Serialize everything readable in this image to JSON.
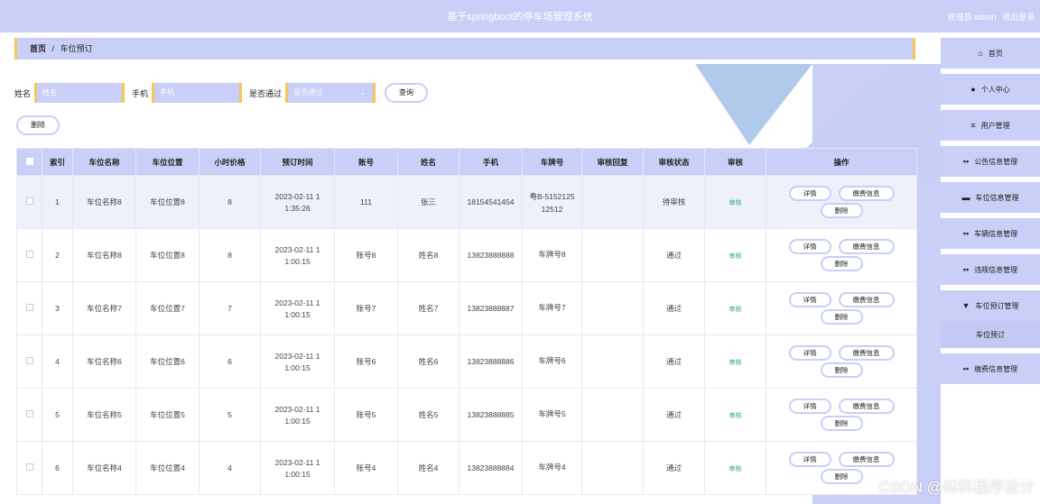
{
  "header": {
    "title": "基于springboot的停车场管理系统",
    "role": "管理员 admin",
    "logout": "退出登录"
  },
  "breadcrumb": {
    "home": "首页",
    "sep": "/",
    "current": "车位预订"
  },
  "search": {
    "name_label": "姓名",
    "name_placeholder": "姓名",
    "phone_label": "手机",
    "phone_placeholder": "手机",
    "pass_label": "是否通过",
    "pass_placeholder": "是否通过",
    "query_button": "查询"
  },
  "delete_button": "删除",
  "table": {
    "headers": [
      "索引",
      "车位名称",
      "车位位置",
      "小时价格",
      "预订时间",
      "账号",
      "姓名",
      "手机",
      "车牌号",
      "审核回复",
      "审核状态",
      "审核",
      "操作"
    ],
    "rows": [
      {
        "index": "1",
        "name": "车位名称8",
        "loc": "车位位置8",
        "price": "8",
        "time1": "2023-02-11 1",
        "time2": "1:35:26",
        "account": "111",
        "person": "张三",
        "phone": "18154541454",
        "plate1": "粤B-5152125",
        "plate2": "12512",
        "reply": "",
        "status": "待审核",
        "audit": "审核"
      },
      {
        "index": "2",
        "name": "车位名称8",
        "loc": "车位位置8",
        "price": "8",
        "time1": "2023-02-11 1",
        "time2": "1:00:15",
        "account": "账号8",
        "person": "姓名8",
        "phone": "13823888888",
        "plate1": "车牌号8",
        "plate2": "",
        "reply": "",
        "status": "通过",
        "audit": "审核"
      },
      {
        "index": "3",
        "name": "车位名称7",
        "loc": "车位位置7",
        "price": "7",
        "time1": "2023-02-11 1",
        "time2": "1:00:15",
        "account": "账号7",
        "person": "姓名7",
        "phone": "13823888887",
        "plate1": "车牌号7",
        "plate2": "",
        "reply": "",
        "status": "通过",
        "audit": "审核"
      },
      {
        "index": "4",
        "name": "车位名称6",
        "loc": "车位位置6",
        "price": "6",
        "time1": "2023-02-11 1",
        "time2": "1:00:15",
        "account": "账号6",
        "person": "姓名6",
        "phone": "13823888886",
        "plate1": "车牌号6",
        "plate2": "",
        "reply": "",
        "status": "通过",
        "audit": "审核"
      },
      {
        "index": "5",
        "name": "车位名称5",
        "loc": "车位位置5",
        "price": "5",
        "time1": "2023-02-11 1",
        "time2": "1:00:15",
        "account": "账号5",
        "person": "姓名5",
        "phone": "13823888885",
        "plate1": "车牌号5",
        "plate2": "",
        "reply": "",
        "status": "通过",
        "audit": "审核"
      },
      {
        "index": "6",
        "name": "车位名称4",
        "loc": "车位位置4",
        "price": "4",
        "time1": "2023-02-11 1",
        "time2": "1:00:15",
        "account": "账号4",
        "person": "姓名4",
        "phone": "13823888884",
        "plate1": "车牌号4",
        "plate2": "",
        "reply": "",
        "status": "通过",
        "audit": "审核"
      }
    ],
    "op_detail": "详情",
    "op_pay": "缴费信息",
    "op_delete": "删除"
  },
  "sidebar": {
    "items": [
      {
        "icon": "home-icon",
        "glyph": "⌂",
        "label": "首页"
      },
      {
        "icon": "user-icon",
        "glyph": "●",
        "label": "个人中心"
      },
      {
        "icon": "menu-icon",
        "glyph": "≡",
        "label": "用户管理"
      },
      {
        "icon": "grid-icon",
        "glyph": "▪▪",
        "label": "公告信息管理"
      },
      {
        "icon": "briefcase-icon",
        "glyph": "▬",
        "label": "车位信息管理"
      },
      {
        "icon": "grid-icon",
        "glyph": "▪▪",
        "label": "车辆信息管理"
      },
      {
        "icon": "grid-icon",
        "glyph": "▪▪",
        "label": "违规信息管理"
      },
      {
        "icon": "trophy-icon",
        "glyph": "▼",
        "label": "车位预订管理"
      },
      {
        "icon": "",
        "glyph": "",
        "label": "车位预订"
      },
      {
        "icon": "grid-icon",
        "glyph": "▪▪",
        "label": "缴费信息管理"
      }
    ]
  },
  "watermark": "CSDN @林科程序设计"
}
